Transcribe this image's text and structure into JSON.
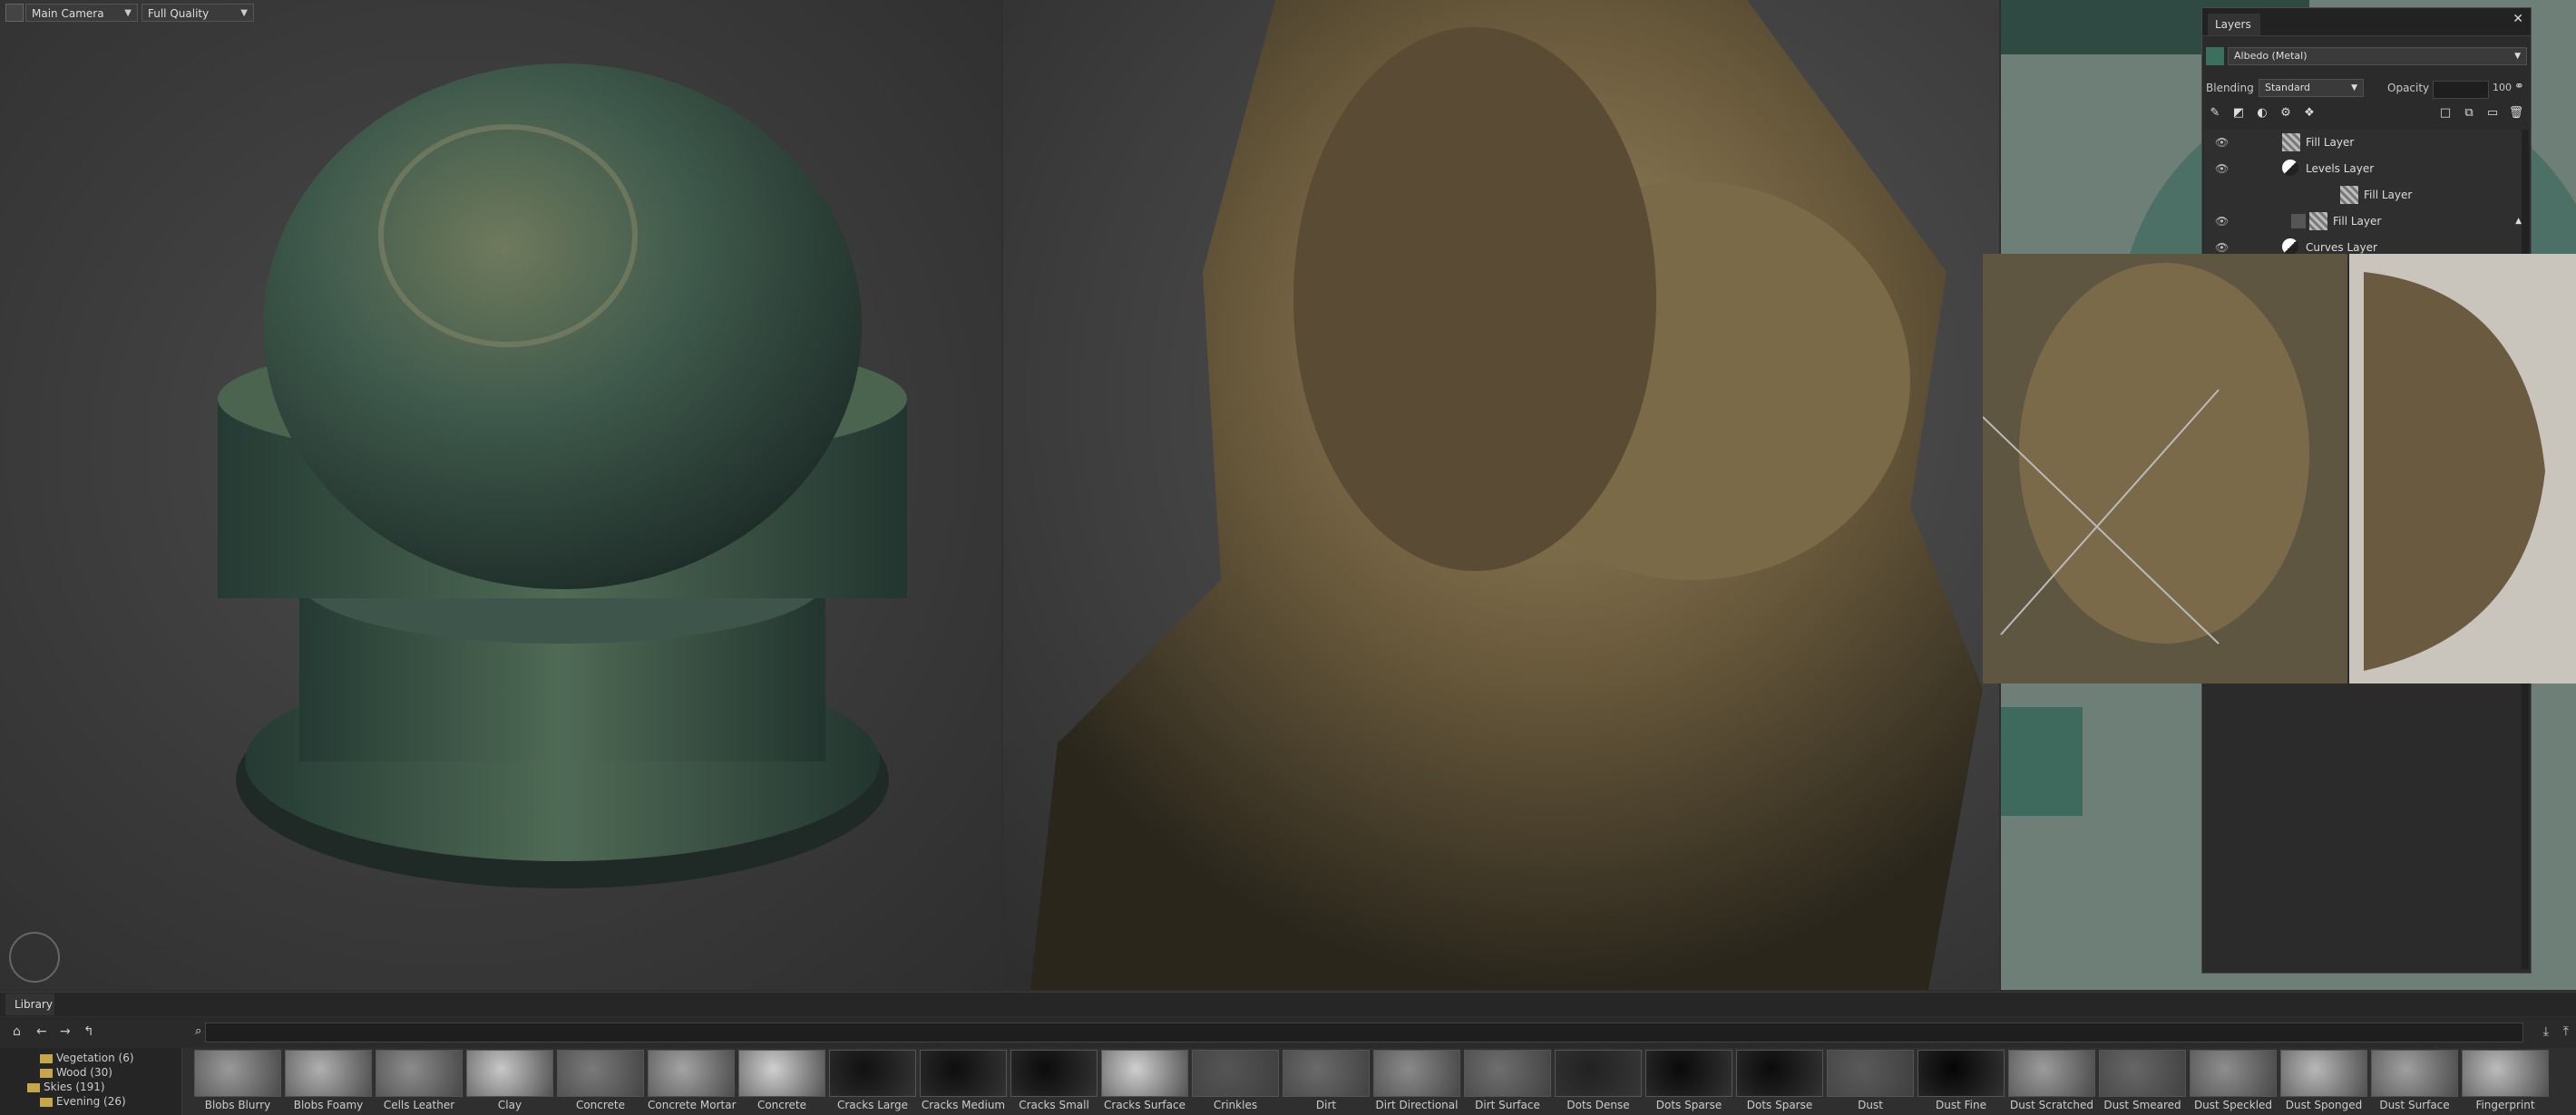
{
  "toolbar": {
    "camera_select": "Main Camera",
    "quality_select": "Full Quality"
  },
  "layers_panel": {
    "tab": "Layers",
    "channel_select": "Albedo (Metal)",
    "blending_label": "Blending",
    "blending_value": "Standard",
    "opacity_label": "Opacity",
    "opacity_value": "100",
    "layers": [
      {
        "name": "Fill Layer",
        "type": "fill",
        "indent": 0
      },
      {
        "name": "Levels Layer",
        "type": "adjustment",
        "indent": 0
      },
      {
        "name": "Fill Layer",
        "type": "fill",
        "indent": 2
      },
      {
        "name": "Fill Layer",
        "type": "fill",
        "indent": 1
      },
      {
        "name": "Curves Layer",
        "type": "adjustment",
        "indent": 0
      }
    ]
  },
  "library": {
    "tab": "Library",
    "tree": [
      {
        "label": "Vegetation (6)"
      },
      {
        "label": "Wood (30)"
      },
      {
        "label": "Skies (191)"
      },
      {
        "label": "Evening (26)"
      }
    ],
    "items": [
      "Blobs Blurry",
      "Blobs Foamy",
      "Cells Leather",
      "Clay",
      "Concrete",
      "Concrete Mortar",
      "Concrete",
      "Cracks Large",
      "Cracks Medium",
      "Cracks Small",
      "Cracks Surface",
      "Crinkles",
      "Dirt",
      "Dirt Directional",
      "Dirt Surface",
      "Dots Dense",
      "Dots Sparse",
      "Dots Sparse",
      "Dust",
      "Dust Fine",
      "Dust Scratched",
      "Dust Smeared",
      "Dust Speckled",
      "Dust Sponged",
      "Dust Surface",
      "Fingerprint"
    ]
  },
  "colors": {
    "bg": "#2f2f2f",
    "panel": "#2b2b2b",
    "folder": "#c9a64a"
  }
}
